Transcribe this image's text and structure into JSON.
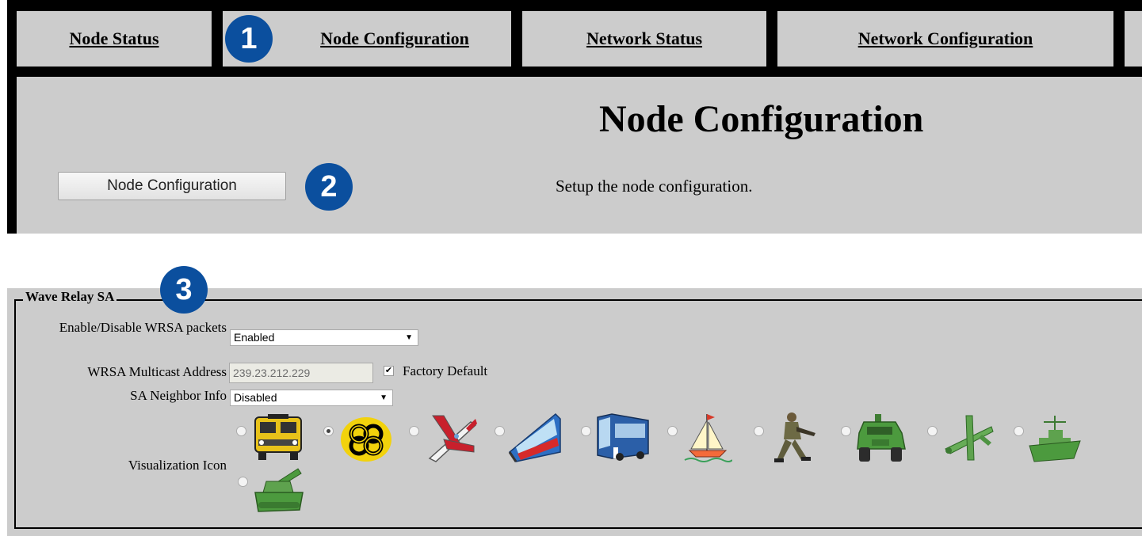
{
  "nav": {
    "tabs": [
      "Node Status",
      "Node Configuration",
      "Network Status",
      "Network Configuration"
    ]
  },
  "header": {
    "title": "Node Configuration",
    "button_label": "Node Configuration",
    "description": "Setup the node configuration."
  },
  "callouts": [
    "1",
    "2",
    "3"
  ],
  "wave_relay_sa": {
    "legend": "Wave Relay SA",
    "enable_label": "Enable/Disable WRSA packets",
    "enable_value": "Enabled",
    "multicast_label": "WRSA Multicast Address",
    "multicast_value": "239.23.212.229",
    "factory_default_label": "Factory Default",
    "factory_default_checked": true,
    "neighbor_label": "SA Neighbor Info",
    "neighbor_value": "Disabled",
    "visualization_label": "Visualization Icon",
    "icons": [
      "school-bus-icon",
      "celtic-knot-icon",
      "airplane-icon",
      "train-icon",
      "bus-icon",
      "sailboat-icon",
      "soldier-icon",
      "humvee-icon",
      "drone-icon",
      "warship-icon",
      "tank-icon"
    ],
    "selected_icon": "celtic-knot-icon"
  },
  "colors": {
    "panel": "#cccccc",
    "badge": "#0b4f9e",
    "military_green": "#4c9a3e",
    "bus_yellow": "#e8c21a"
  }
}
